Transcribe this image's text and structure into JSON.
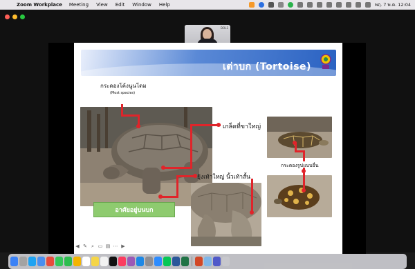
{
  "menubar": {
    "app_name": "Zoom Workplace",
    "menus": [
      "Meeting",
      "View",
      "Edit",
      "Window",
      "Help"
    ],
    "clock": "พฤ. 7 พ.ค.  12:04"
  },
  "video": {
    "tag": "DOL1"
  },
  "slide": {
    "title": "เต่าบก (Tortoise)",
    "label_shell": "กระดองโค้งนูนโดม",
    "label_shell_sub": "(Most species)",
    "label_scales": "เกล็ดที่ขาใหญ่",
    "label_feet": "ยุ้งเท้าใหญ่ นิ้วเท้าสั้น",
    "label_other_shell": "กระดองรูปแบบอื่น",
    "habitat_button": "อาศัยอยู่บนบก"
  },
  "colors": {
    "accent_red": "#e0242a",
    "banner_blue": "#2a62c2",
    "habitat_green": "#8ecb6f"
  },
  "dock_apps": [
    "finder",
    "launchpad",
    "safari",
    "mail",
    "chrome",
    "messages",
    "facetime",
    "photos",
    "calendar",
    "notes",
    "reminders",
    "tv",
    "music",
    "podcasts",
    "appstore",
    "settings",
    "zoom",
    "line",
    "word",
    "excel",
    "powerpoint",
    "preview",
    "teams",
    "trash"
  ]
}
